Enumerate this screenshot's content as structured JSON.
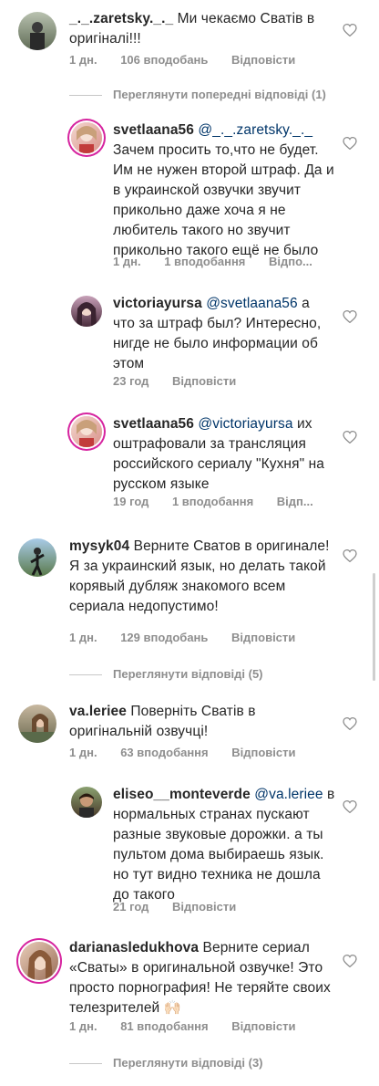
{
  "comments": [
    {
      "username": "_._.zaretsky._._",
      "text": "Ми чекаємо Сватів в оригіналі!!!",
      "time": "1 дн.",
      "likes": "106 вподобань",
      "reply": "Відповісти"
    },
    {
      "view_previous": "Переглянути попередні відповіді (1)"
    },
    {
      "username": "svetlaana56",
      "mention": "@_._.zaretsky._._",
      "text": "Зачем просить то,что не будет. Им не нужен второй штраф. Да и в украинской озвучки звучит прикольно даже хоча я не любитель такого но звучит прикольно такого ещё не было",
      "time": "1 дн.",
      "likes": "1 вподобання",
      "reply": "Відпо..."
    },
    {
      "username": "victoriayursa",
      "mention": "@svetlaana56",
      "text": "а что за штраф был? Интересно, нигде не было информации об этом",
      "time": "23 год",
      "reply": "Відповісти"
    },
    {
      "username": "svetlaana56",
      "mention": "@victoriayursa",
      "text": "их оштрафовали за трансляция российского сериалу \"Кухня\" на русском языке",
      "time": "19 год",
      "likes": "1 вподобання",
      "reply": "Відп..."
    },
    {
      "username": "mysyk04",
      "text": "Верните Сватов в оригинале! Я за украинский язык, но делать такой корявый дубляж знакомого всем сериала недопустимо!",
      "time": "1 дн.",
      "likes": "129 вподобань",
      "reply": "Відповісти",
      "view_replies": "Переглянути відповіді (5)"
    },
    {
      "username": "va.leriee",
      "text": "Поверніть Сватів в оригінальній озвучці!",
      "time": "1 дн.",
      "likes": "63 вподобання",
      "reply": "Відповісти"
    },
    {
      "username": "eliseo__monteverde",
      "mention": "@va.leriee",
      "text": "в нормальных странах пускают разные звуковые дорожки. а ты пультом дома выбираешь язык. но тут видно техника не дошла до такого",
      "time": "21 год",
      "reply": "Відповісти"
    },
    {
      "username": "darianasledukhova",
      "text": "Верните сериал «Сваты» в оригинальной озвучке! Это просто порнография! Не теряйте своих телезрителей 🙌🏻",
      "time": "1 дн.",
      "likes": "81 вподобання",
      "reply": "Відповісти",
      "view_replies": "Переглянути відповіді (3)"
    }
  ],
  "colors": {
    "username": "#262626",
    "mention": "#003569",
    "meta": "#8e8e8e",
    "story_ring": "#d6249f"
  }
}
